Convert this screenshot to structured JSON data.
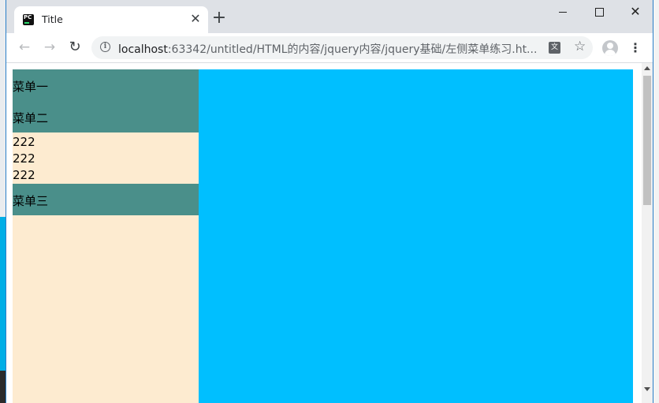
{
  "tab": {
    "title": "Title",
    "favicon_text": "PC"
  },
  "window_controls": {
    "close_glyph": "✕"
  },
  "toolbar": {
    "url_host": "localhost",
    "url_path": ":63342/untitled/HTML的内容/jquery内容/jquery基础/左侧菜单练习.ht...",
    "translate_label": "文"
  },
  "page": {
    "menus": [
      {
        "label": "菜单一",
        "items": []
      },
      {
        "label": "菜单二",
        "items": [
          "222",
          "222",
          "222"
        ]
      },
      {
        "label": "菜单三",
        "items": []
      }
    ]
  },
  "colors": {
    "menu_header_bg": "#4a8f8a",
    "sidebar_bg": "#fdebd0",
    "content_bg": "#00bfff",
    "tabstrip_bg": "#dee1e6"
  },
  "icons": [
    "favicon-icon",
    "close-icon",
    "new-tab-icon",
    "minimize-icon",
    "maximize-icon",
    "back-icon",
    "forward-icon",
    "reload-icon",
    "info-icon",
    "translate-icon",
    "star-icon",
    "profile-icon",
    "menu-icon"
  ]
}
